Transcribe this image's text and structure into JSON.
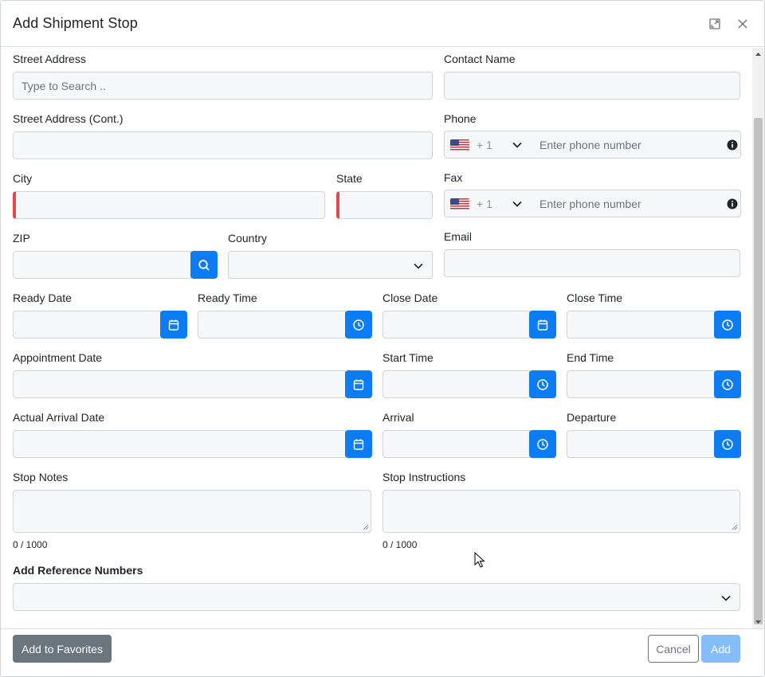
{
  "modal": {
    "title": "Add Shipment Stop"
  },
  "form": {
    "street_address": {
      "label": "Street Address",
      "placeholder": "Type to Search .."
    },
    "street_address_cont": {
      "label": "Street Address (Cont.)"
    },
    "city": {
      "label": "City"
    },
    "state": {
      "label": "State"
    },
    "zip": {
      "label": "ZIP"
    },
    "country": {
      "label": "Country"
    },
    "contact_name": {
      "label": "Contact Name"
    },
    "phone": {
      "label": "Phone",
      "dial_code": "+ 1",
      "placeholder": "Enter phone number"
    },
    "fax": {
      "label": "Fax",
      "dial_code": "+ 1",
      "placeholder": "Enter phone number"
    },
    "email": {
      "label": "Email"
    },
    "ready_date": {
      "label": "Ready Date"
    },
    "ready_time": {
      "label": "Ready Time"
    },
    "close_date": {
      "label": "Close Date"
    },
    "close_time": {
      "label": "Close Time"
    },
    "appointment_date": {
      "label": "Appointment Date"
    },
    "start_time": {
      "label": "Start Time"
    },
    "end_time": {
      "label": "End Time"
    },
    "actual_arrival_date": {
      "label": "Actual Arrival Date"
    },
    "arrival": {
      "label": "Arrival"
    },
    "departure": {
      "label": "Departure"
    },
    "stop_notes": {
      "label": "Stop Notes",
      "counter": "0 / 1000"
    },
    "stop_instructions": {
      "label": "Stop Instructions",
      "counter": "0 / 1000"
    },
    "reference_numbers": {
      "label": "Add Reference Numbers"
    }
  },
  "footer": {
    "favorites_label": "Add to Favorites",
    "cancel_label": "Cancel",
    "add_label": "Add"
  },
  "colors": {
    "primary": "#0d7cf2",
    "required": "#e04a4a",
    "secondary": "#6c757d",
    "disabled_primary": "#84bcf7"
  }
}
